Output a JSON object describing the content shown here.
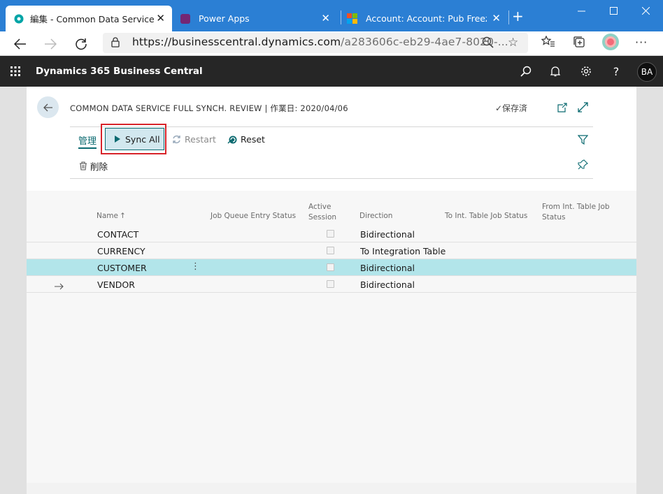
{
  "browser": {
    "tabs": [
      {
        "title": "編集 - Common Data Service Full",
        "active": true,
        "icon": "bc-logo-icon"
      },
      {
        "title": "Power Apps",
        "active": false,
        "icon": "power-apps-icon"
      },
      {
        "title": "Account: Account: Pub Freeza Es",
        "active": false,
        "icon": "microsoft-logo-icon"
      }
    ],
    "url_host": "https://businesscentral.dynamics.com",
    "url_path": "/a283606c-eb29-4ae7-8020-..."
  },
  "app": {
    "title": "Dynamics 365 Business Central",
    "user_initials": "BA"
  },
  "page": {
    "title": "COMMON DATA SERVICE FULL SYNCH. REVIEW | 作業日: 2020/04/06",
    "saved_status": "✓保存済",
    "tab_manage": "管理",
    "actions": {
      "sync_all": "Sync All",
      "restart": "Restart",
      "reset": "Reset",
      "delete": "削除"
    }
  },
  "grid": {
    "columns": {
      "name": "Name",
      "sort_indicator": "↑",
      "job_queue_status": "Job Queue Entry Status",
      "active_session_1": "Active",
      "active_session_2": "Session",
      "direction": "Direction",
      "to_int_status": "To Int. Table Job Status",
      "from_int_status_1": "From Int. Table Job",
      "from_int_status_2": "Status"
    },
    "rows": [
      {
        "name": "CONTACT",
        "active_session": false,
        "direction": "Bidirectional"
      },
      {
        "name": "CURRENCY",
        "active_session": false,
        "direction": "To Integration Table"
      },
      {
        "name": "CUSTOMER",
        "active_session": false,
        "direction": "Bidirectional",
        "selected": true
      },
      {
        "name": "VENDOR",
        "active_session": false,
        "direction": "Bidirectional"
      }
    ]
  },
  "colors": {
    "accent": "#0b6a70",
    "highlight_box": "#d8232a",
    "selected_row": "#b2e5ea",
    "browser_frame": "#2b7fd4"
  }
}
